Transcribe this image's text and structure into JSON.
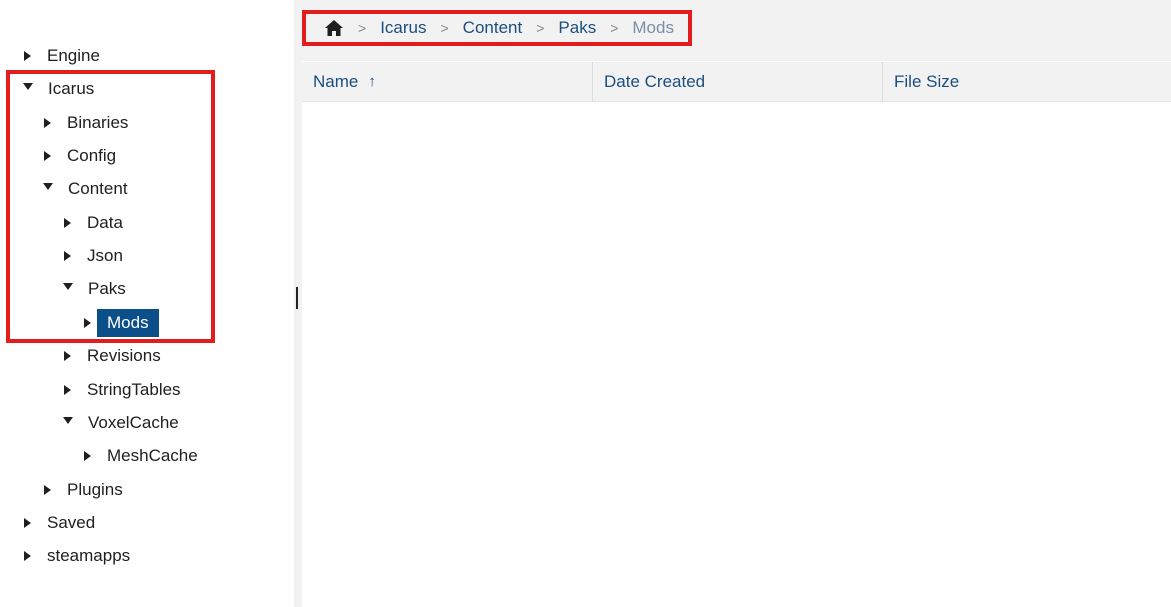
{
  "tree": [
    {
      "label": "Engine",
      "state": "collapsed",
      "depth": 0
    },
    {
      "label": "Icarus",
      "state": "expanded",
      "depth": 0
    },
    {
      "label": "Binaries",
      "state": "collapsed",
      "depth": 1
    },
    {
      "label": "Config",
      "state": "collapsed",
      "depth": 1
    },
    {
      "label": "Content",
      "state": "expanded",
      "depth": 1
    },
    {
      "label": "Data",
      "state": "collapsed",
      "depth": 2
    },
    {
      "label": "Json",
      "state": "collapsed",
      "depth": 2
    },
    {
      "label": "Paks",
      "state": "expanded",
      "depth": 2
    },
    {
      "label": "Mods",
      "state": "collapsed",
      "depth": 3,
      "selected": true
    },
    {
      "label": "Revisions",
      "state": "collapsed",
      "depth": 2
    },
    {
      "label": "StringTables",
      "state": "collapsed",
      "depth": 2
    },
    {
      "label": "VoxelCache",
      "state": "expanded",
      "depth": 2
    },
    {
      "label": "MeshCache",
      "state": "collapsed",
      "depth": 3
    },
    {
      "label": "Plugins",
      "state": "collapsed",
      "depth": 1
    },
    {
      "label": "Saved",
      "state": "collapsed",
      "depth": 0
    },
    {
      "label": "steamapps",
      "state": "collapsed",
      "depth": 0
    }
  ],
  "breadcrumb": {
    "home_icon": "home-icon",
    "items": [
      {
        "label": "Icarus"
      },
      {
        "label": "Content"
      },
      {
        "label": "Paks"
      },
      {
        "label": "Mods",
        "current": true
      }
    ],
    "separator": ">"
  },
  "columns": {
    "name": "Name",
    "date": "Date Created",
    "size": "File Size",
    "sort_indicator": "↑"
  },
  "colors": {
    "accent": "#1a4f80",
    "selection": "#0b4f8a",
    "highlight_frame": "#e21d1d"
  }
}
